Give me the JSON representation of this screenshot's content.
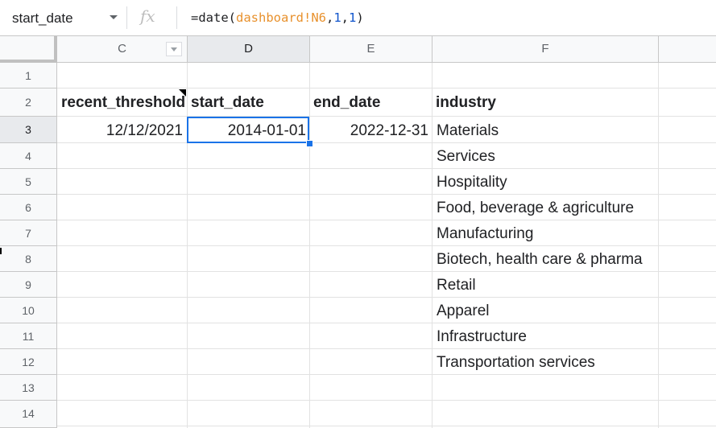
{
  "formula_bar": {
    "name_box": "start_date",
    "fx_label": "fx",
    "formula_prefix": "=date(",
    "formula_ref": "dashboard!N6",
    "formula_sep1": ",",
    "formula_arg1": "1",
    "formula_sep2": ",",
    "formula_arg2": "1",
    "formula_suffix": ")"
  },
  "columns": [
    "C",
    "D",
    "E",
    "F",
    ""
  ],
  "rows": [
    "1",
    "2",
    "3",
    "4",
    "5",
    "6",
    "7",
    "8",
    "9",
    "10",
    "11",
    "12",
    "13",
    "14"
  ],
  "headers": {
    "recent_threshold": "recent_threshold",
    "start_date": "start_date",
    "end_date": "end_date",
    "industry": "industry"
  },
  "values": {
    "recent_threshold": "12/12/2021",
    "start_date": "2014-01-01",
    "end_date": "2022-12-31"
  },
  "industries": [
    "Materials",
    "Services",
    "Hospitality",
    "Food, beverage & agriculture",
    "Manufacturing",
    "Biotech, health care & pharma",
    "Retail",
    "Apparel",
    "Infrastructure",
    "Transportation services"
  ],
  "selected_cell": "D3"
}
